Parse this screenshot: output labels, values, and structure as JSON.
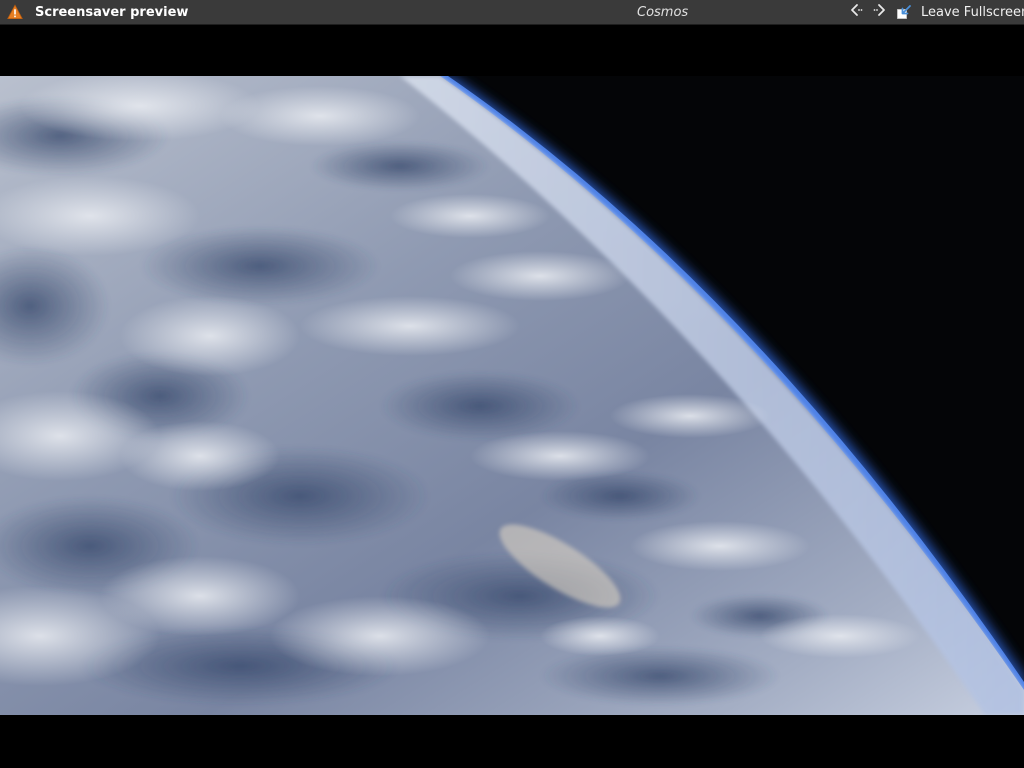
{
  "toolbar": {
    "title": "Screensaver preview",
    "screensaver_name": "Cosmos",
    "leave_fullscreen_label": "Leave Fullscreen",
    "warning_icon": "warning-icon",
    "prev_icon": "arrow-left-icon",
    "next_icon": "arrow-right-icon",
    "leave_icon": "leave-fullscreen-icon"
  },
  "colors": {
    "toolbar_bg": "#3a3a3a",
    "warning": "#e67e22",
    "space": "#050608",
    "atmosphere": "#3b6fd4",
    "cloud": "#c9ced8",
    "ocean": "#3d4f73"
  }
}
